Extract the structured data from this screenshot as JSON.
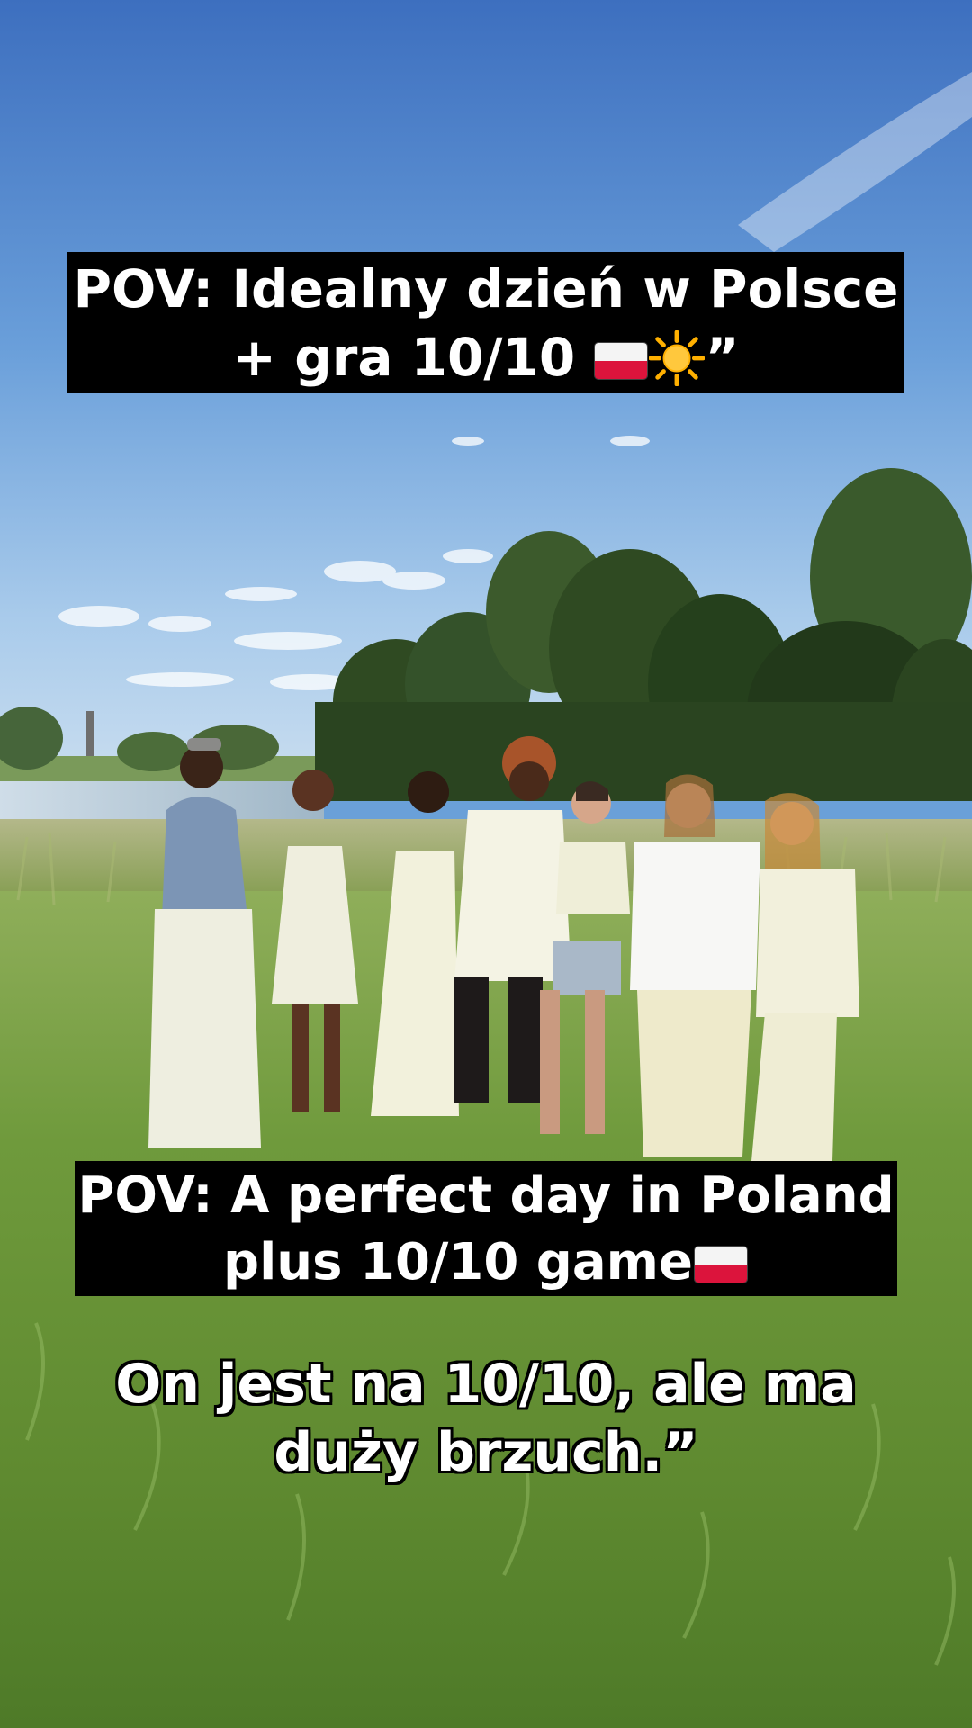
{
  "captions": {
    "top_line1": "POV: Idealny dzień w Polsce",
    "top_line2": "+ gra 10/10",
    "top_suffix": "”",
    "middle_line1": "POV: A perfect day in Poland",
    "middle_line2": "plus 10/10 game",
    "bottom_line1": "On jest na 10/10, ale ma",
    "bottom_line2": "duży brzuch.”"
  },
  "emoji": {
    "top": [
      "poland-flag-icon",
      "sun-icon"
    ],
    "middle": [
      "poland-flag-icon"
    ]
  },
  "colors": {
    "caption_background": "#000000",
    "caption_text": "#ffffff",
    "flag_white": "#f4f4f4",
    "flag_red": "#dc143c",
    "sun": "#ffc83d"
  }
}
